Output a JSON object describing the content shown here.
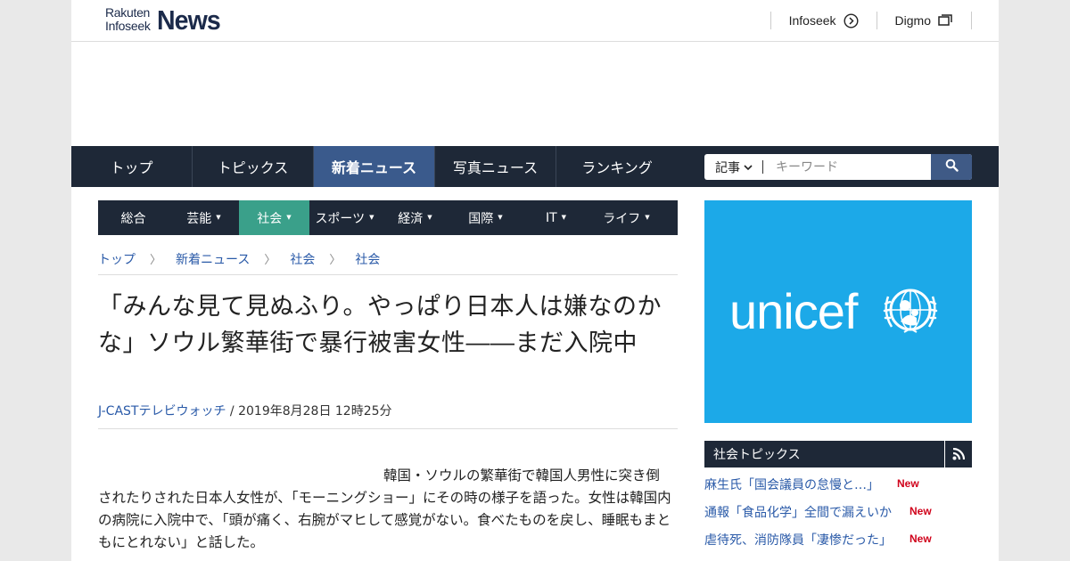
{
  "header": {
    "logo_small_1": "Rakuten",
    "logo_small_2": "Infoseek",
    "logo_big": "News",
    "links": [
      {
        "label": "Infoseek",
        "icon": "arrow-circle-icon"
      },
      {
        "label": "Digmo",
        "icon": "windows-icon"
      }
    ]
  },
  "main_nav": {
    "items": [
      "トップ",
      "トピックス",
      "新着ニュース",
      "写真ニュース",
      "ランキング"
    ],
    "active": "新着ニュース"
  },
  "search": {
    "scope": "記事",
    "placeholder": "キーワード"
  },
  "category_nav": {
    "items": [
      "総合",
      "芸能",
      "社会",
      "スポーツ",
      "経済",
      "国際",
      "IT",
      "ライフ"
    ],
    "active": "社会"
  },
  "breadcrumb": [
    "トップ",
    "新着ニュース",
    "社会",
    "社会"
  ],
  "article": {
    "title": "「みんな見て見ぬふり。やっぱり日本人は嫌なのかな」ソウル繁華街で暴行被害女性――まだ入院中",
    "source": "J-CASTテレビウォッチ",
    "date": " / 2019年8月28日 12時25分",
    "body": "韓国・ソウルの繁華街で韓国人男性に突き倒されたりされた日本人女性が、「モーニングショー」にその時の様子を語った。女性は韓国内の病院に入院中で、「頭が痛く、右腕がマヒして感覚がない。食べたものを戻し、睡眠もまともにとれない」と話した。"
  },
  "ad": {
    "brand": "unicef",
    "color": "#1ca9e8"
  },
  "topics": {
    "title": "社会トピックス",
    "items": [
      {
        "text": "麻生氏「国会議員の怠慢と…」",
        "badge": "New"
      },
      {
        "text": "通報「食品化学」全間で漏えいか",
        "badge": "New"
      },
      {
        "text": "虐待死、消防隊員「凄惨だった」",
        "badge": "New"
      }
    ]
  }
}
